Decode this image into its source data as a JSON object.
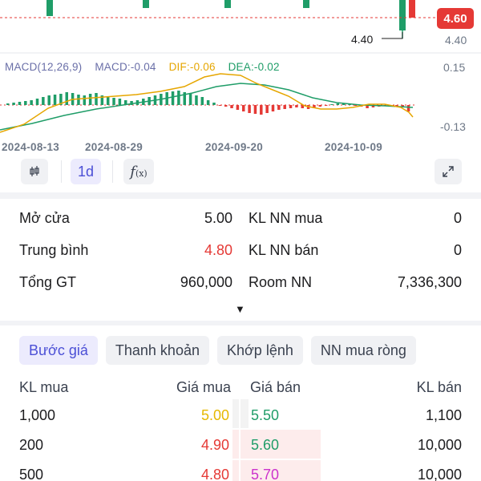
{
  "chart": {
    "current_price_badge": "4.60",
    "axis_price_label": "4.40",
    "callout_label": "4.40",
    "macd_legend": {
      "name": "MACD(12,26,9)",
      "macd": "MACD:-0.04",
      "dif": "DIF:-0.06",
      "dea": "DEA:-0.02"
    },
    "macd_axis_top": "0.15",
    "macd_axis_bottom": "-0.13",
    "dates": [
      "2024-08-13",
      "2024-08-29",
      "2024-09-20",
      "2024-10-09"
    ],
    "colors": {
      "up": "#1f9d68",
      "down": "#e53935",
      "dif": "#e6a600",
      "dea": "#1f9d68",
      "accent": "#4b4fd6"
    }
  },
  "toolbar": {
    "candle_icon": "candlestick-icon",
    "interval_label": "1d",
    "function_icon": "function-icon",
    "expand_icon": "expand-icon"
  },
  "stats": {
    "rows": [
      {
        "left_label": "Mở cửa",
        "left_value": "5.00",
        "right_label": "KL NN mua",
        "right_value": "0"
      },
      {
        "left_label": "Trung bình",
        "left_value": "4.80",
        "right_label": "KL NN bán",
        "right_value": "0"
      },
      {
        "left_label": "Tổng GT",
        "left_value": "960,000",
        "right_label": "Room NN",
        "right_value": "7,336,300"
      }
    ],
    "expand_arrow": "▼"
  },
  "tabs": [
    "Bước giá",
    "Thanh khoản",
    "Khớp lệnh",
    "NN mua ròng"
  ],
  "orderbook": {
    "headers": {
      "buy_volume": "KL mua",
      "buy_price": "Giá mua",
      "sell_price": "Giá bán",
      "sell_volume": "KL bán"
    },
    "rows": [
      {
        "buy_volume": "1,000",
        "buy_price": "5.00",
        "sell_price": "5.50",
        "sell_volume": "1,100"
      },
      {
        "buy_volume": "200",
        "buy_price": "4.90",
        "sell_price": "5.60",
        "sell_volume": "10,000"
      },
      {
        "buy_volume": "500",
        "buy_price": "4.80",
        "sell_price": "5.70",
        "sell_volume": "10,000"
      }
    ],
    "price_colors": {
      "buy": [
        "#e6b800",
        "#e53935",
        "#e53935"
      ],
      "sell": [
        "#1f9d68",
        "#1f9d68",
        "#cc33cc"
      ]
    }
  }
}
